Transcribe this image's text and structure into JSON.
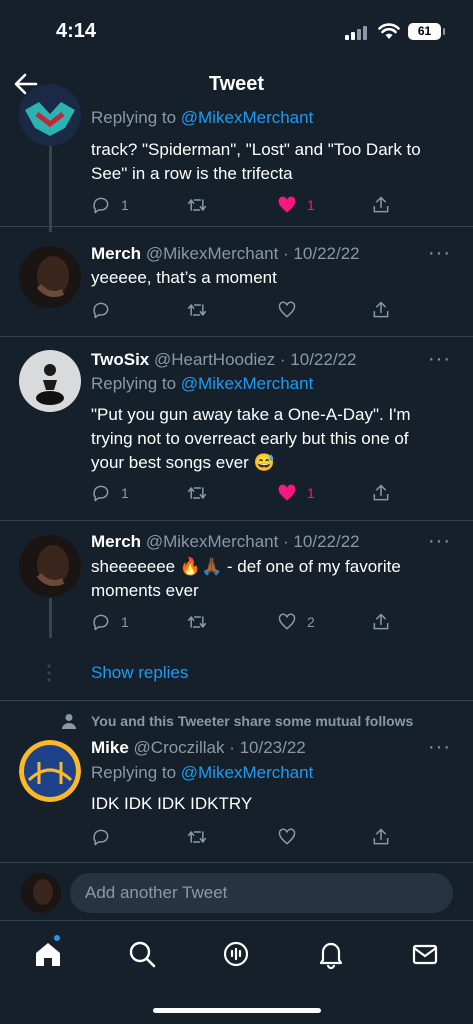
{
  "status_bar": {
    "time": "4:14",
    "battery": "61"
  },
  "header": {
    "title": "Tweet"
  },
  "tweets": [
    {
      "replying_label": "Replying to",
      "replying_handle": "@MikexMerchant",
      "text": "track? \"Spiderman\", \"Lost\" and \"Too Dark to See\" in a row is the trifecta",
      "replies": "1",
      "retweets": "",
      "likes": "1",
      "liked": true
    },
    {
      "name": "Merch",
      "handle": "@MikexMerchant · 10/22/22",
      "text": "yeeeee, that’s a moment",
      "replies": "",
      "retweets": "",
      "likes": ""
    },
    {
      "name": "TwoSix",
      "handle": "@HeartHoodiez · 10/22/22",
      "replying_label": "Replying to",
      "replying_handle": "@MikexMerchant",
      "text": "\"Put you gun away take a One-A-Day\". I'm trying not to overreact early but this one of your best songs ever 😅",
      "replies": "1",
      "retweets": "",
      "likes": "1",
      "liked": true
    },
    {
      "name": "Merch",
      "handle": "@MikexMerchant · 10/22/22",
      "text": "sheeeeeee 🔥🙏🏾 - def one of my favorite moments ever",
      "replies": "1",
      "retweets": "",
      "likes": "2"
    },
    {
      "name": "Mike",
      "handle": "@Croczillak · 10/23/22",
      "replying_label": "Replying to",
      "replying_handle": "@MikexMerchant",
      "text": "IDK IDK IDK  IDKTRY",
      "replies": "",
      "retweets": "",
      "likes": ""
    }
  ],
  "show_replies": "Show replies",
  "mutual_follows": "You and this Tweeter share some mutual follows",
  "compose": {
    "placeholder": "Add another Tweet"
  },
  "more_label": "···",
  "icons": [
    "back-arrow-icon",
    "reply-icon",
    "retweet-icon",
    "like-icon",
    "share-icon",
    "home-icon",
    "search-icon",
    "spaces-icon",
    "notifications-icon",
    "messages-icon"
  ],
  "colors": {
    "background": "#15202b",
    "accent": "#1d9bf0",
    "like": "#f91880",
    "muted": "#8b98a5"
  }
}
